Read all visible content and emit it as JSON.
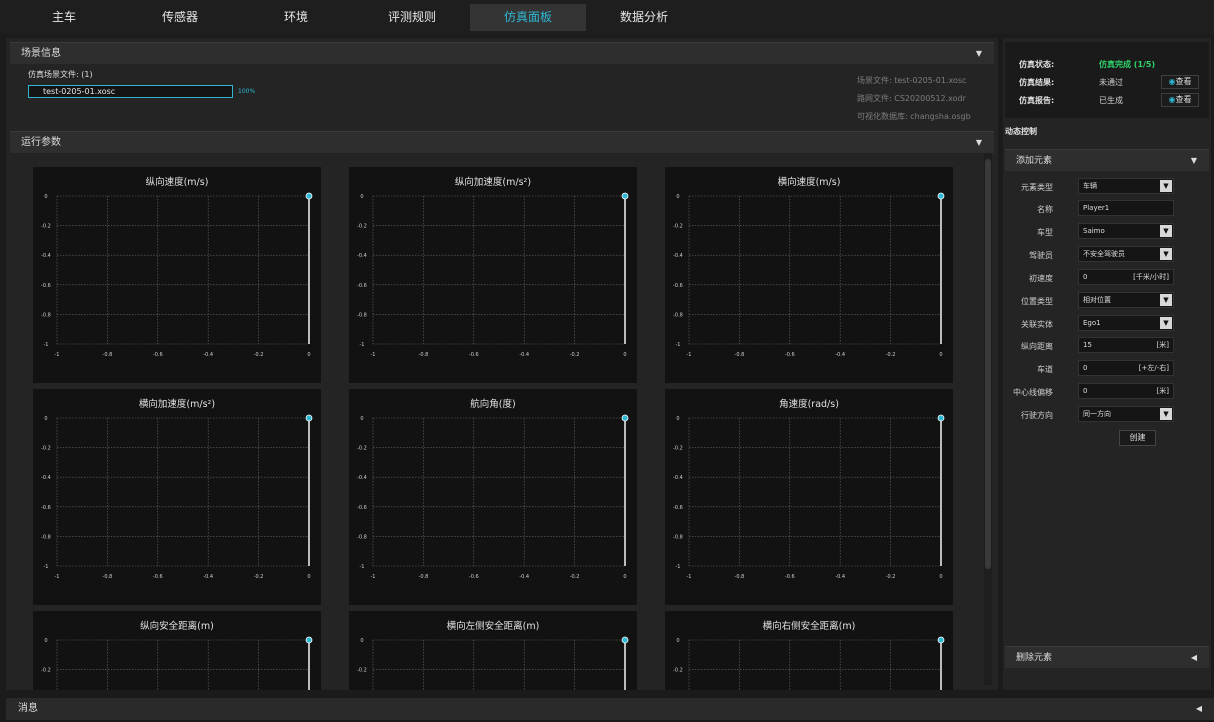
{
  "nav": {
    "tabs": [
      {
        "label": "主车",
        "active": false
      },
      {
        "label": "传感器",
        "active": false
      },
      {
        "label": "环境",
        "active": false
      },
      {
        "label": "评测规则",
        "active": false
      },
      {
        "label": "仿真面板",
        "active": true
      },
      {
        "label": "数据分析",
        "active": false
      }
    ]
  },
  "scene": {
    "header": "场景信息",
    "files_label": "仿真场景文件: (1)",
    "file_name": "test-0205-01.xosc",
    "progress_text": "100%",
    "progress_value": 1.0,
    "meta": {
      "scene_file": "场景文件: test-0205-01.xosc",
      "road_file": "路网文件: CS20200512.xodr",
      "vis_db": "可视化数据库: changsha.osgb"
    }
  },
  "params": {
    "header": "运行参数"
  },
  "charts": {
    "x_ticks": [
      "-1",
      "-0.8",
      "-0.6",
      "-0.4",
      "-0.2",
      "0"
    ],
    "y_ticks": [
      "0",
      "-0.2",
      "-0.4",
      "-0.6",
      "-0.8",
      "-1"
    ],
    "items": [
      {
        "title": "纵向速度(m/s)"
      },
      {
        "title": "纵向加速度(m/s²)"
      },
      {
        "title": "横向速度(m/s)"
      },
      {
        "title": "横向加速度(m/s²)"
      },
      {
        "title": "航向角(度)"
      },
      {
        "title": "角速度(rad/s)"
      },
      {
        "title": "纵向安全距离(m)"
      },
      {
        "title": "横向左侧安全距离(m)"
      },
      {
        "title": "横向右侧安全距离(m)"
      }
    ]
  },
  "chart_data": {
    "type": "scatter",
    "series": [
      {
        "x": [
          0
        ],
        "y": [
          0
        ]
      }
    ],
    "xlim": [
      -1,
      0
    ],
    "ylim": [
      -1,
      0
    ],
    "grid": true
  },
  "status": {
    "state_label": "仿真状态:",
    "state_value": "仿真完成 (1/5)",
    "state_color": "#2ed26a",
    "result_label": "仿真结果:",
    "result_value": "未通过",
    "report_label": "仿真报告:",
    "report_value": "已生成",
    "view_label": "查看",
    "accent": "#2fb7d3"
  },
  "dynamic": {
    "title": "动态控制",
    "add_header": "添加元素",
    "delete_header": "删除元素",
    "create_label": "创建",
    "fields": {
      "element_type": {
        "label": "元素类型",
        "value": "车辆"
      },
      "name": {
        "label": "名称",
        "value": "Player1"
      },
      "model": {
        "label": "车型",
        "value": "Saimo"
      },
      "driver": {
        "label": "驾驶员",
        "value": "不安全驾驶员"
      },
      "init_speed": {
        "label": "初速度",
        "value": "0",
        "unit": "[千米/小时]"
      },
      "pos_type": {
        "label": "位置类型",
        "value": "相对位置"
      },
      "entity": {
        "label": "关联实体",
        "value": "Ego1"
      },
      "long_dist": {
        "label": "纵向距离",
        "value": "15",
        "unit": "[米]"
      },
      "lane": {
        "label": "车道",
        "value": "0",
        "unit": "[+左/-右]"
      },
      "offset": {
        "label": "中心线偏移",
        "value": "0",
        "unit": "[米]"
      },
      "direction": {
        "label": "行驶方向",
        "value": "同一方向"
      }
    }
  },
  "message": {
    "label": "消息"
  }
}
